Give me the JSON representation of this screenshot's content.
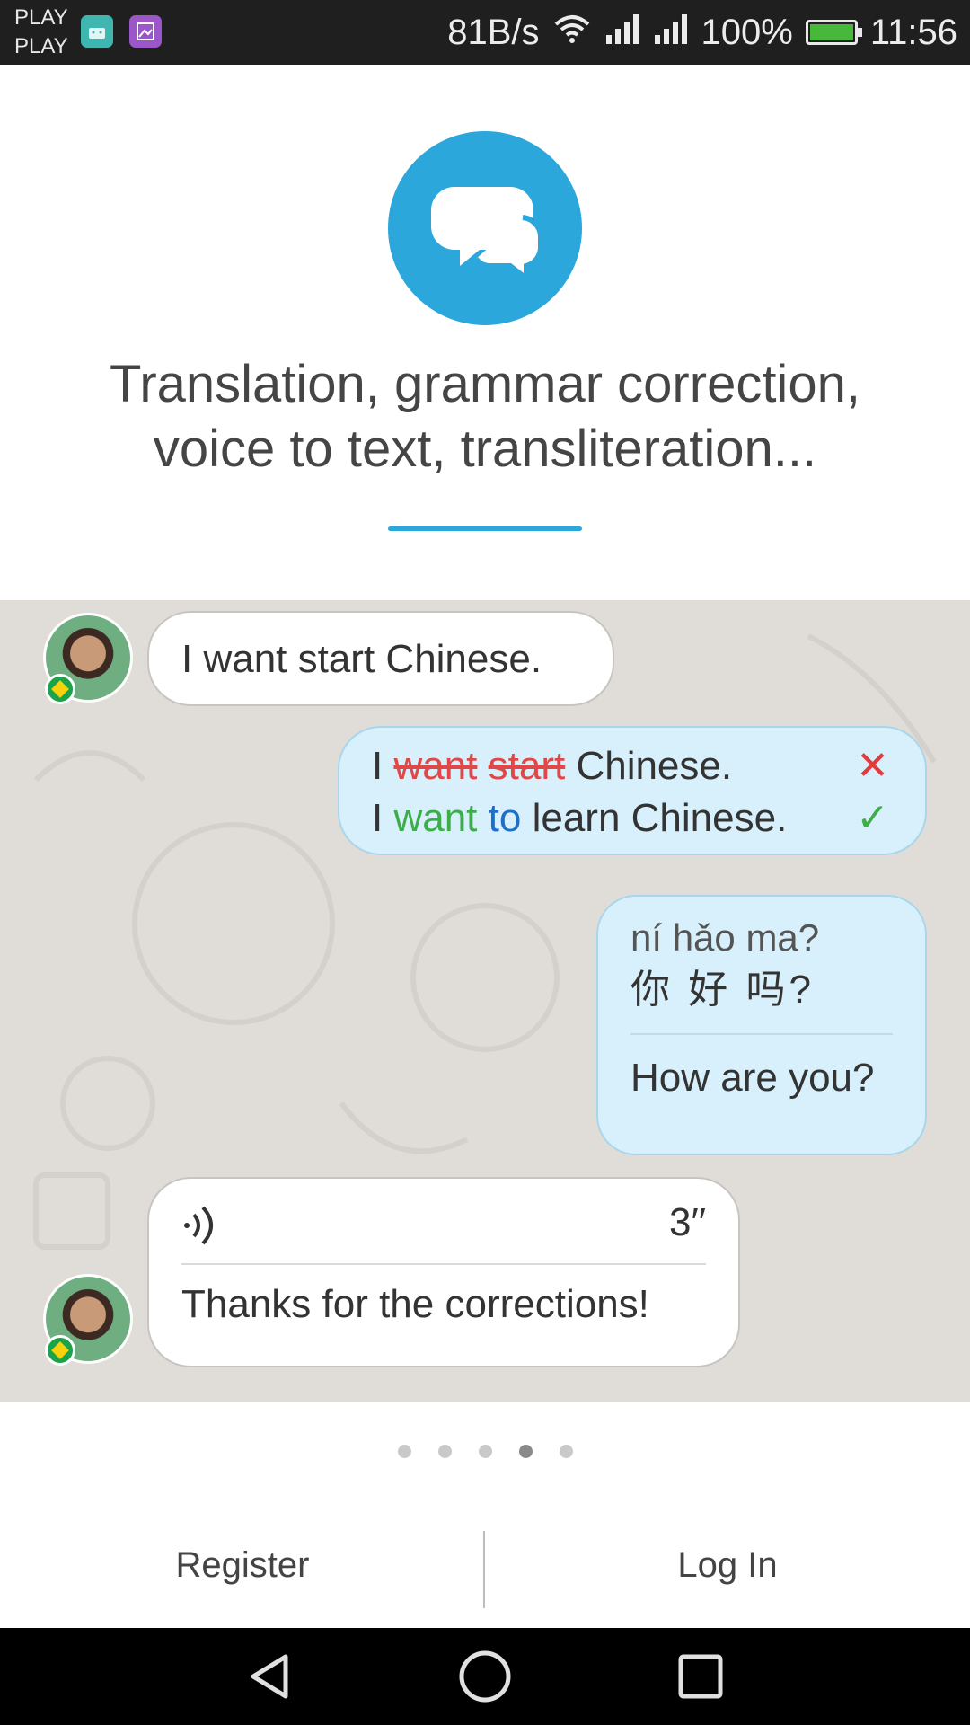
{
  "status_bar": {
    "carrier_line1": "PLAY",
    "carrier_line2": "PLAY",
    "network_speed": "81B/s",
    "battery": "100%",
    "time": "11:56",
    "battery_level": 1.0
  },
  "hero": {
    "icon": "chat-bubbles-icon",
    "title_line1": "Translation, grammar correction,",
    "title_line2": "voice to text, transliteration..."
  },
  "chat": {
    "message1": "I want start Chinese.",
    "correction": {
      "original_prefix": "I ",
      "original_struck1": "want",
      "original_struck2": "start",
      "original_suffix": " Chinese.",
      "corrected_prefix": "I ",
      "corrected_word1": "want",
      "corrected_word2": "to",
      "corrected_suffix": " learn Chinese."
    },
    "transliteration": {
      "pinyin": "ní hǎo ma?",
      "hanzi": "你 好  吗?",
      "translation": "How are you?"
    },
    "voice_message": {
      "duration": "3′′",
      "text": "Thanks for the corrections!"
    }
  },
  "pager": {
    "count": 5,
    "active_index": 3
  },
  "actions": {
    "register": "Register",
    "login": "Log In"
  },
  "colors": {
    "accent": "#2ba7dc",
    "chat_background": "#e0ddd9",
    "correction_red": "#e04848",
    "correction_green": "#3cae49",
    "correction_blue": "#1f6fc7"
  }
}
